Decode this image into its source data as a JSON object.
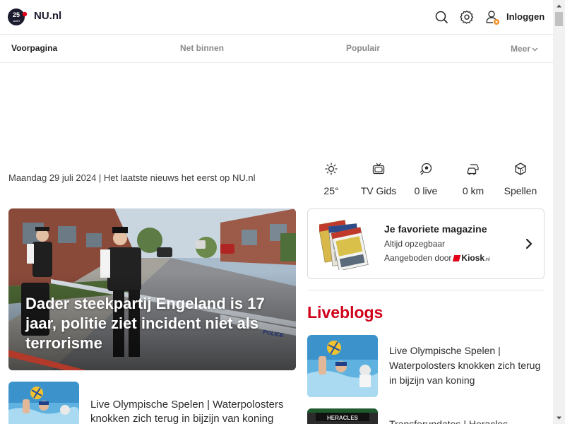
{
  "header": {
    "logo_badge_text": "25",
    "logo_badge_sub": "JAAR",
    "logo_text": "NU.nl",
    "login_label": "Inloggen",
    "icons": [
      "search-icon",
      "gear-icon",
      "user-icon"
    ]
  },
  "nav": {
    "items": [
      {
        "label": "Voorpagina",
        "active": true
      },
      {
        "label": "Net binnen",
        "active": false
      },
      {
        "label": "Populair",
        "active": false
      }
    ],
    "more_label": "Meer"
  },
  "dateline": "Maandag 29 juli 2024 | Het laatste nieuws het eerst op NU.nl",
  "widgets": [
    {
      "icon": "sun-icon",
      "label": "25°"
    },
    {
      "icon": "tv-icon",
      "label": "TV Gids"
    },
    {
      "icon": "soccer-ball-icon",
      "label": "0 live"
    },
    {
      "icon": "cars-icon",
      "label": "0 km"
    },
    {
      "icon": "cube-icon",
      "label": "Spellen"
    }
  ],
  "hero": {
    "title": "Dader steekpartij Engeland is 17 jaar, politie ziet incident niet als terrorisme",
    "tape_text": "POLICE"
  },
  "small_article": {
    "title": "Live Olympische Spelen | Waterpolosters knokken zich terug in bijzijn van koning"
  },
  "magazine": {
    "title": "Je favoriete magazine",
    "subtitle": "Altijd opzegbaar",
    "offered_by": "Aangeboden door",
    "brand": "Kiosk",
    "brand_suffix": ".nl"
  },
  "liveblogs": {
    "heading": "Liveblogs",
    "items": [
      {
        "title": "Live Olympische Spelen | Waterpolosters knokken zich terug in bijzijn van koning"
      },
      {
        "title": "Transferupdates | Heracles"
      }
    ],
    "thumb2_text": "HERACLES"
  },
  "colors": {
    "accent_red": "#d0021b",
    "navy": "#1b1b2f",
    "badge_orange": "#f08c1a"
  }
}
